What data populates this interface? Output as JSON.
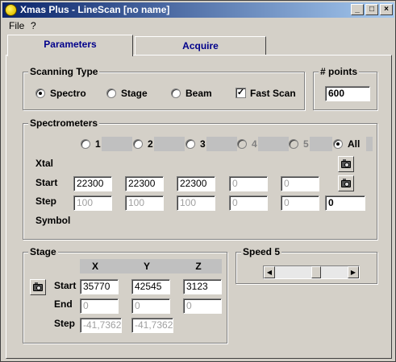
{
  "window": {
    "title": "Xmas Plus - LineScan [no name]",
    "controls": [
      "_",
      "□",
      "×"
    ]
  },
  "menu": {
    "file": "File",
    "help": "?"
  },
  "tabs": [
    {
      "label": "Parameters",
      "active": true
    },
    {
      "label": "Acquire",
      "active": false
    }
  ],
  "scanning_type": {
    "title": "Scanning Type",
    "options": [
      {
        "label": "Spectro",
        "checked": true
      },
      {
        "label": "Stage",
        "checked": false
      },
      {
        "label": "Beam",
        "checked": false
      }
    ],
    "fast_scan": {
      "label": "Fast Scan",
      "checked": true
    }
  },
  "points": {
    "title": "# points",
    "value": "600"
  },
  "spectrometers": {
    "title": "Spectrometers",
    "selectors": [
      {
        "label": "1",
        "enabled": true
      },
      {
        "label": "2",
        "enabled": true
      },
      {
        "label": "3",
        "enabled": true
      },
      {
        "label": "4",
        "enabled": false
      },
      {
        "label": "5",
        "enabled": false
      },
      {
        "label": "All",
        "enabled": true,
        "checked": true
      }
    ],
    "row_labels": {
      "xtal": "Xtal",
      "start": "Start",
      "step": "Step",
      "symbol": "Symbol"
    },
    "start": [
      "22300",
      "22300",
      "22300",
      "0",
      "0"
    ],
    "step": [
      "100",
      "100",
      "100",
      "0",
      "0",
      "0"
    ]
  },
  "stage": {
    "title": "Stage",
    "axes": [
      "X",
      "Y",
      "Z"
    ],
    "row_labels": {
      "start": "Start",
      "end": "End",
      "step": "Step"
    },
    "start": [
      "35770",
      "42545",
      "3123"
    ],
    "end": [
      "0",
      "0",
      "0"
    ],
    "step": [
      "-41,7362",
      "-41,7362"
    ]
  },
  "speed": {
    "title": "Speed 5",
    "level": 5,
    "min": 1,
    "max": 8
  }
}
